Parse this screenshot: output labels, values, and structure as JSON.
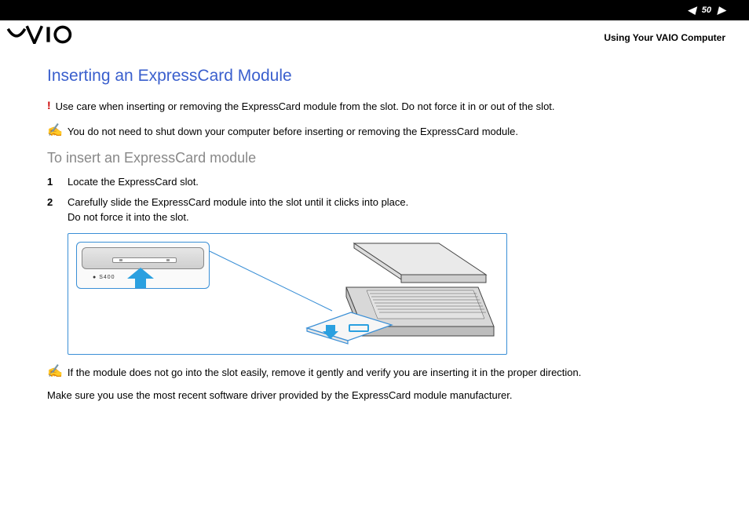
{
  "header": {
    "page_number": "50",
    "breadcrumb": "Using Your VAIO Computer"
  },
  "logo_alt": "VAIO",
  "title": "Inserting an ExpressCard Module",
  "warning_text": "Use care when inserting or removing the ExpressCard module from the slot. Do not force it in or out of the slot.",
  "note1_text": "You do not need to shut down your computer before inserting or removing the ExpressCard module.",
  "subtitle": "To insert an ExpressCard module",
  "steps": [
    "Locate the ExpressCard slot.",
    "Carefully slide the ExpressCard module into the slot until it clicks into place.\nDo not force it into the slot."
  ],
  "inset_label": "S400",
  "note2_text": "If the module does not go into the slot easily, remove it gently and verify you are inserting it in the proper direction.",
  "para_text": "Make sure you use the most recent software driver provided by the ExpressCard module manufacturer."
}
